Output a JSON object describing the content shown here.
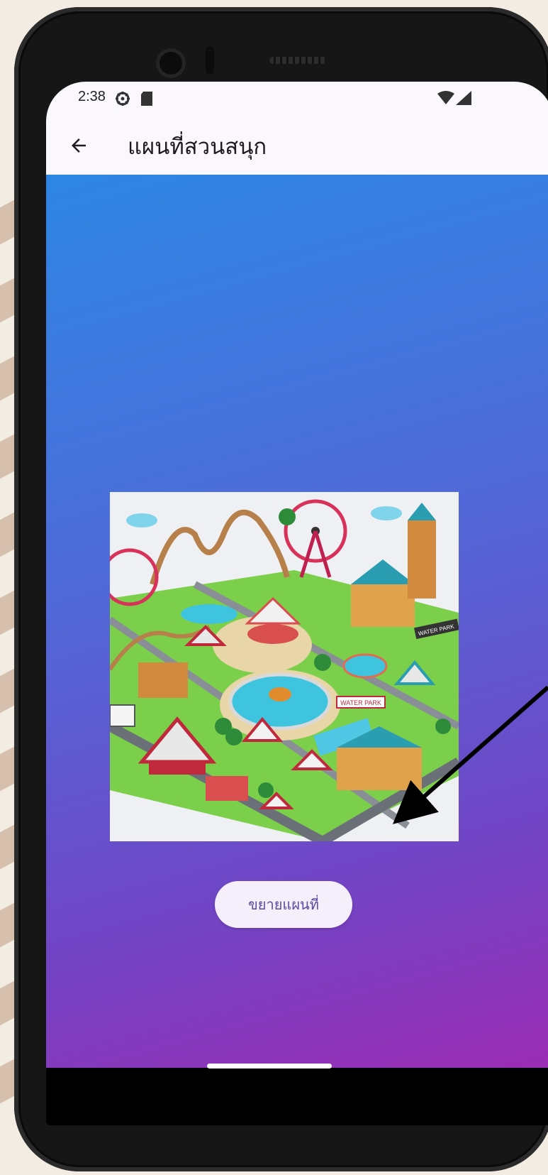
{
  "status_bar": {
    "time": "2:38",
    "icons": [
      "settings-gear-icon",
      "sd-card-icon",
      "wifi-icon",
      "cellular-signal-icon"
    ]
  },
  "app_bar": {
    "back_icon": "arrow-back-icon",
    "title": "แผนที่สวนสนุก"
  },
  "main": {
    "map_image_description": "amusement-park-map",
    "map_signs": [
      "WATER PARK",
      "WATER PARK"
    ],
    "expand_button_label": "ขยายแผนที่"
  },
  "colors": {
    "gradient_start": "#2d86e4",
    "gradient_end": "#9b2db4",
    "app_bar_bg": "#fbf8fd",
    "button_bg": "#f4effa",
    "button_text": "#5c4a9e"
  },
  "annotation": {
    "arrow": "pointer-to-expand-button"
  }
}
